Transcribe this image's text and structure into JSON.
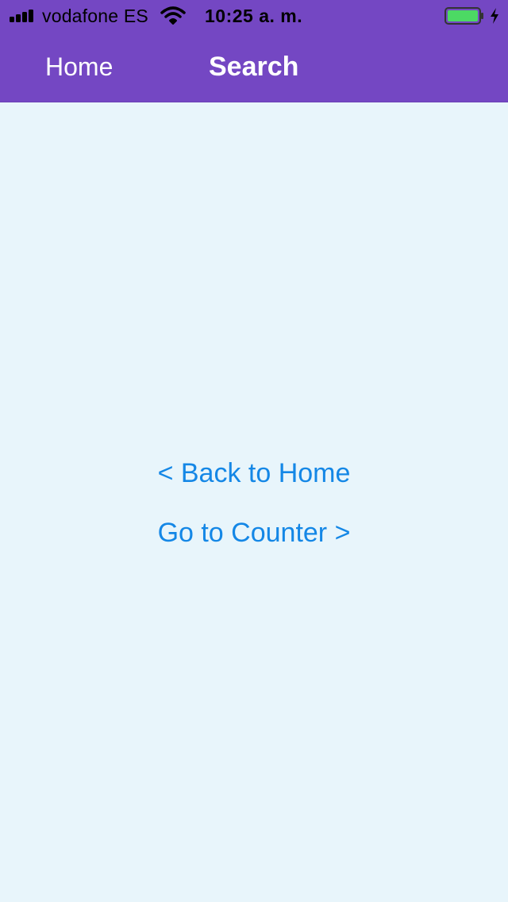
{
  "status_bar": {
    "carrier": "vodafone ES",
    "time": "10:25 a. m.",
    "signal_icon": "signal-bars-icon",
    "wifi_icon": "wifi-icon",
    "battery_icon": "battery-icon",
    "charging_icon": "charging-bolt-icon",
    "battery_level": 1.0,
    "battery_color": "#4cd964"
  },
  "nav_bar": {
    "back_label": "Home",
    "title": "Search",
    "background_color": "#7447c3"
  },
  "main": {
    "back_link": "< Back to Home",
    "counter_link": "Go to Counter >",
    "link_color": "#1487e6",
    "background_color": "#e8f5fb"
  }
}
